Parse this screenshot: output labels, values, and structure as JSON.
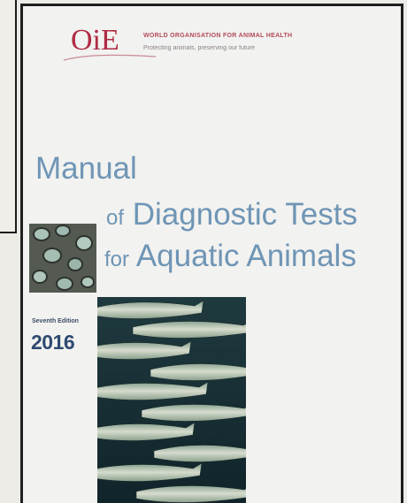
{
  "cover": {
    "logo_text": "OiE",
    "org_name": "WORLD ORGANISATION FOR ANIMAL HEALTH",
    "org_tagline": "Protecting animals, preserving our future",
    "title_line1": "Manual",
    "title_line2_prefix": "of",
    "title_line2_rest": "Diagnostic Tests",
    "title_line3_prefix": "for",
    "title_line3_rest": "Aquatic Animals",
    "edition_label": "Seventh Edition",
    "edition_year": "2016"
  },
  "colors": {
    "title_blue": "#6f95b5",
    "logo_red": "#b02a43",
    "year_navy": "#2e4a70"
  },
  "images": {
    "cells_photo": "microscope-cells-image",
    "fish_photo": "fish-school-image"
  }
}
